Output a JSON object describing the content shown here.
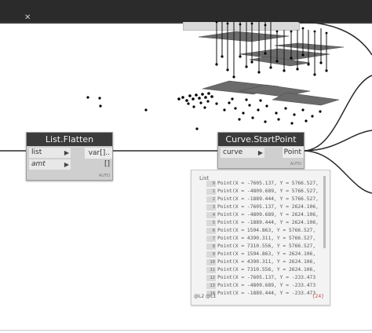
{
  "window": {
    "close_glyph": "✕"
  },
  "nodes": {
    "list_flatten": {
      "title": "List.Flatten",
      "inputs": [
        "list",
        "amt"
      ],
      "output": "var[]..[]",
      "lacing": "AUTO"
    },
    "curve_startpoint": {
      "title": "Curve.StartPoint",
      "inputs": [
        "curve"
      ],
      "output": "Point",
      "lacing": "AUTO"
    }
  },
  "watch": {
    "title": "List",
    "rows": [
      {
        "index": "0",
        "text": "Point(X = -7605.137, Y = 5766.527,"
      },
      {
        "index": "1",
        "text": "Point(X = -4809.689, Y = 5766.527,"
      },
      {
        "index": "2",
        "text": "Point(X = -1889.444, Y = 5766.527,"
      },
      {
        "index": "3",
        "text": "Point(X = -7605.137, Y = 2624.106,"
      },
      {
        "index": "4",
        "text": "Point(X = -4809.689, Y = 2624.106,"
      },
      {
        "index": "5",
        "text": "Point(X = -1889.444, Y = 2624.106,"
      },
      {
        "index": "6",
        "text": "Point(X = 1594.863, Y = 5766.527,"
      },
      {
        "index": "7",
        "text": "Point(X = 4390.311, Y = 5766.527,"
      },
      {
        "index": "8",
        "text": "Point(X = 7310.556, Y = 5766.527,"
      },
      {
        "index": "9",
        "text": "Point(X = 1594.863, Y = 2624.106,"
      },
      {
        "index": "10",
        "text": "Point(X = 4390.311, Y = 2624.106,"
      },
      {
        "index": "11",
        "text": "Point(X = 7310.556, Y = 2624.106,"
      },
      {
        "index": "12",
        "text": "Point(X = -7605.137, Y = -233.473"
      },
      {
        "index": "13",
        "text": "Point(X = -4809.689, Y = -233.473"
      },
      {
        "index": "14",
        "text": "Point(X = -1889.444, Y = -233.473"
      },
      {
        "index": "15",
        "text": "Point(X = -7605.137, Y = -3375.89"
      }
    ],
    "levels": "@L2 @L1",
    "count": "{24}"
  },
  "colors": {
    "header_bg": "#3b3b3b",
    "node_bg": "#cfcfcf",
    "wire": "#2a2a2a",
    "count_accent": "#c0504d"
  }
}
